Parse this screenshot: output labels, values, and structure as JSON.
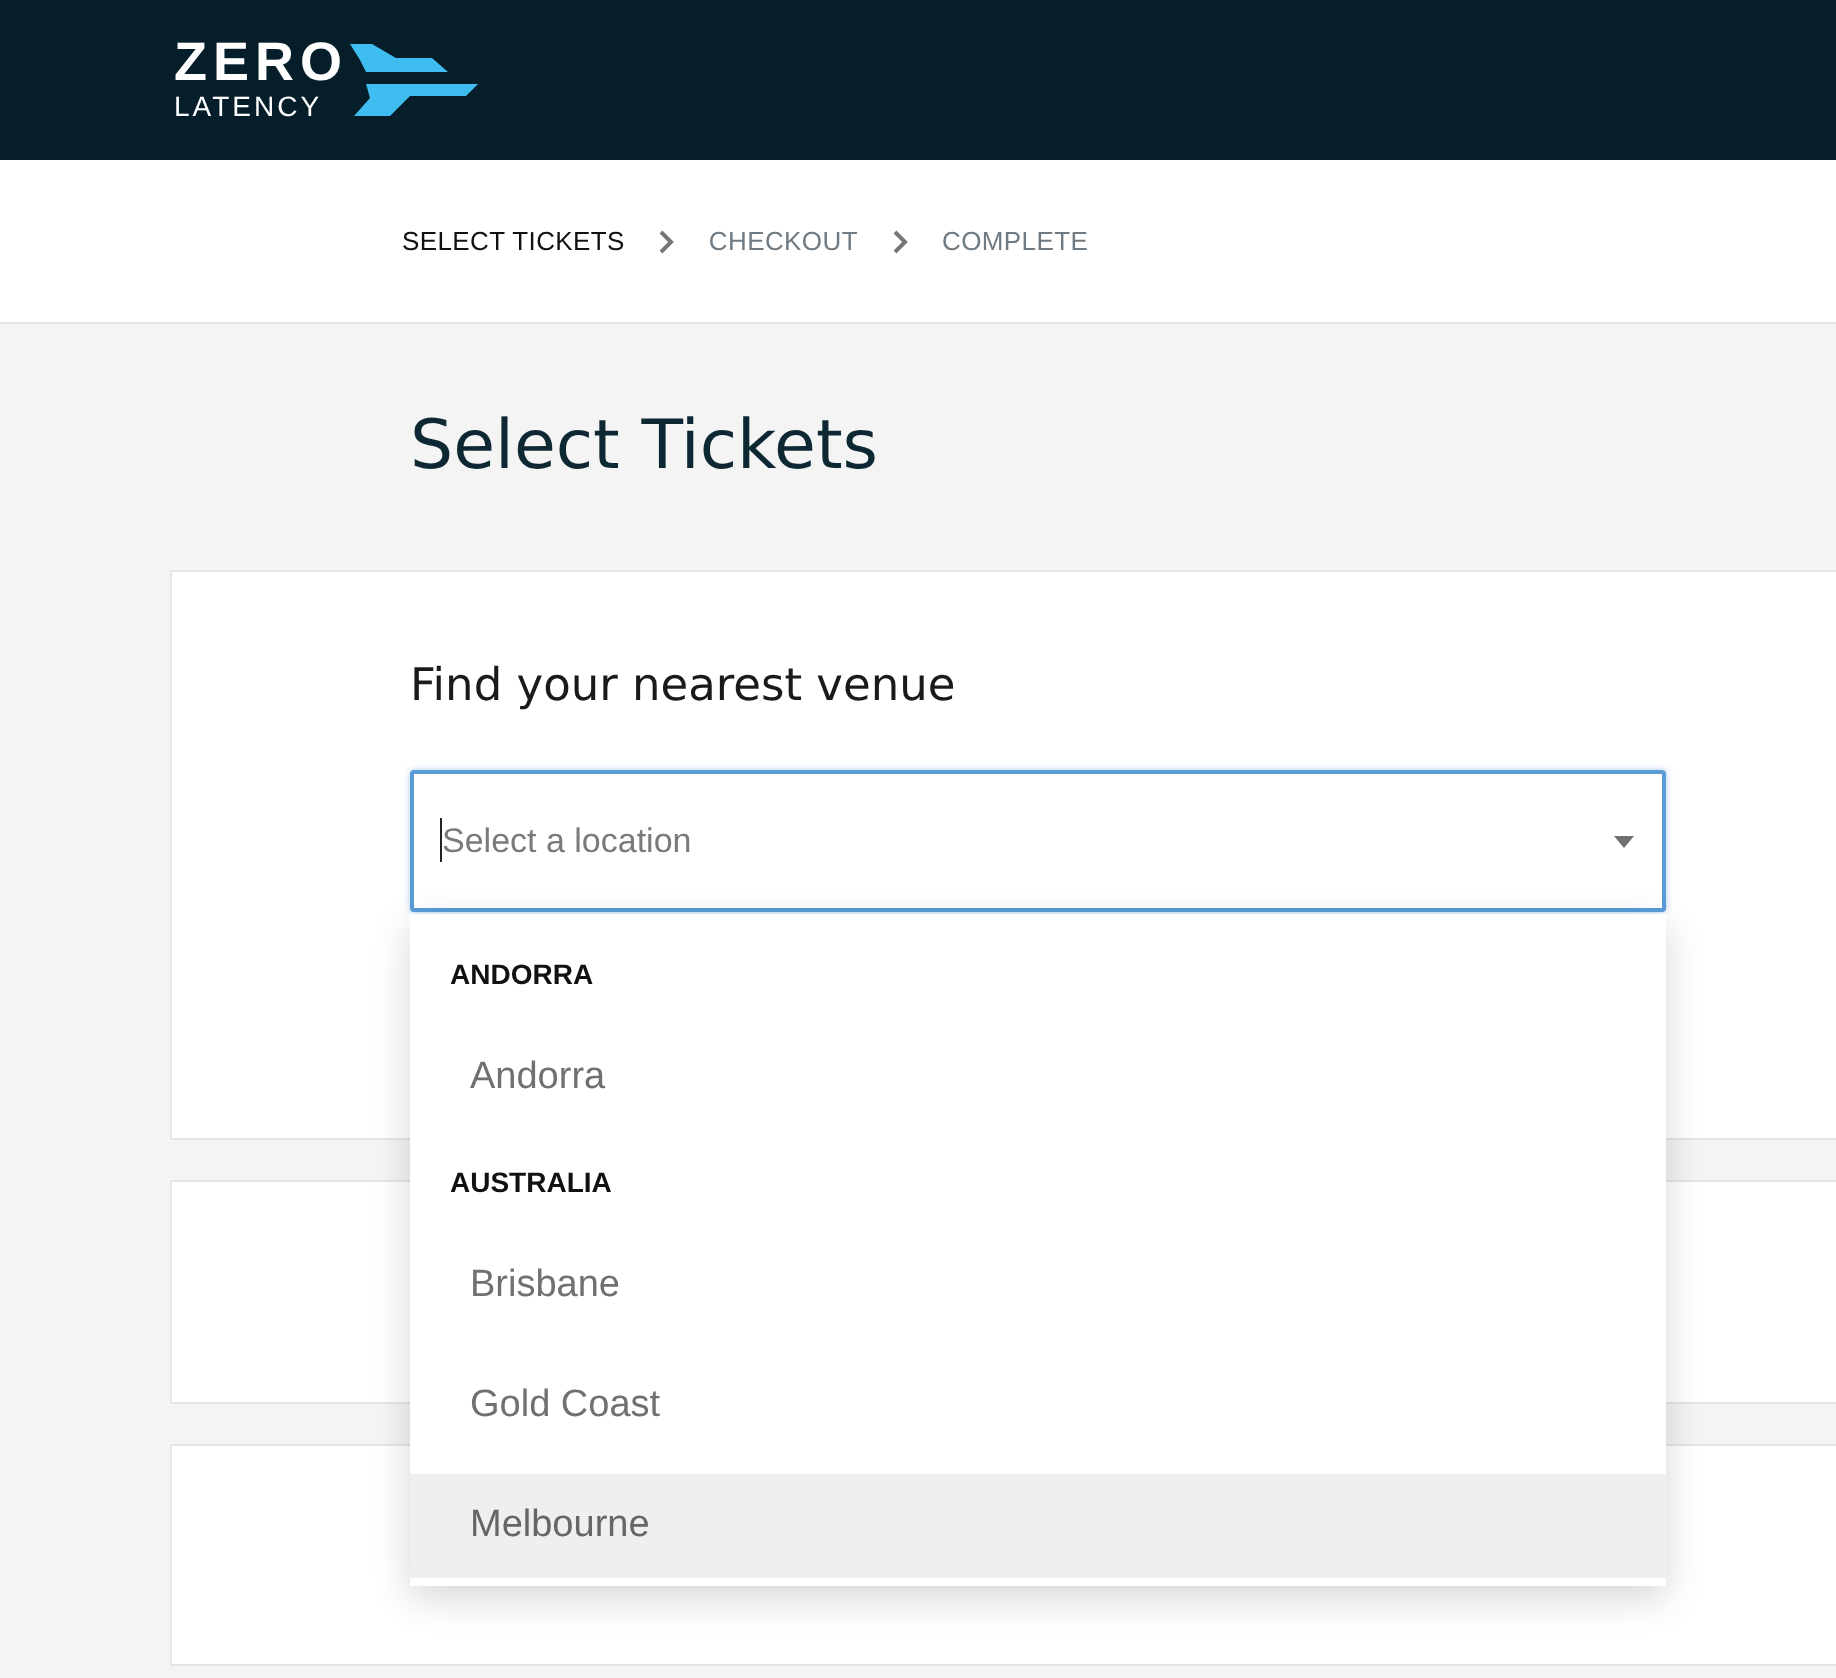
{
  "header": {
    "logo": {
      "line_1": "ZERO",
      "line_2": "LATENCY"
    }
  },
  "steps": [
    {
      "label": "SELECT TICKETS",
      "selected": true
    },
    {
      "label": "CHECKOUT",
      "selected": false
    },
    {
      "label": "COMPLETE",
      "selected": false
    }
  ],
  "title": "Select Tickets",
  "venue_card": {
    "label": "Find your nearest venue",
    "select": {
      "placeholder": "Select a location",
      "focused": true,
      "open": true,
      "groups": [
        {
          "heading": "ANDORRA",
          "options": [
            {
              "label": "Andorra",
              "highlighted": false
            }
          ]
        },
        {
          "heading": "AUSTRALIA",
          "options": [
            {
              "label": "Brisbane",
              "highlighted": false
            },
            {
              "label": "Gold Coast",
              "highlighted": false
            },
            {
              "label": "Melbourne",
              "highlighted": true
            }
          ]
        }
      ]
    }
  }
}
